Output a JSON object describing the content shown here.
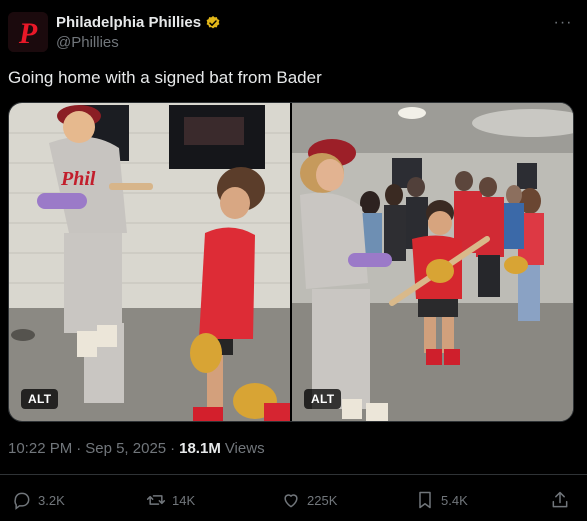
{
  "account": {
    "display_name": "Philadelphia Phillies",
    "handle": "@Phillies",
    "verified_badge": "gold-check-icon",
    "avatar_letter": "P"
  },
  "tweet": {
    "text": "Going home with a signed bat from Bader",
    "time": "10:22 PM",
    "separator": "·",
    "date": "Sep 5, 2025",
    "views_count": "18.1M",
    "views_label": "Views"
  },
  "media": [
    {
      "alt_label": "ALT"
    },
    {
      "alt_label": "ALT"
    }
  ],
  "actions": {
    "replies": "3.2K",
    "reposts": "14K",
    "likes": "225K",
    "bookmarks": "5.4K"
  },
  "colors": {
    "background": "#000000",
    "text": "#e7e9ea",
    "muted": "#71767b",
    "phillies_red": "#e81828",
    "verified_gold": "#e2b719"
  }
}
